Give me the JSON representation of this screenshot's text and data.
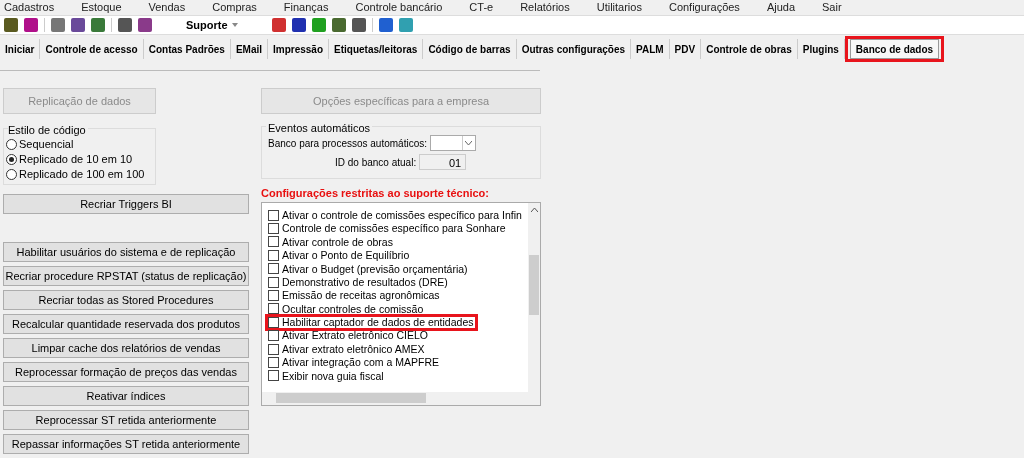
{
  "menu": [
    "Cadastros",
    "Estoque",
    "Vendas",
    "Compras",
    "Finanças",
    "Controle bancário",
    "CT-e",
    "Relatórios",
    "Utilitarios",
    "Configurações",
    "Ajuda",
    "Sair"
  ],
  "toolbar": {
    "dropdown": "Suporte"
  },
  "tabs": [
    {
      "label": "Iniciar",
      "selected": false,
      "highlighted": false
    },
    {
      "label": "Controle de acesso",
      "selected": false,
      "highlighted": false
    },
    {
      "label": "Contas Padrões",
      "selected": false,
      "highlighted": false
    },
    {
      "label": "EMail",
      "selected": false,
      "highlighted": false
    },
    {
      "label": "Impressão",
      "selected": false,
      "highlighted": false
    },
    {
      "label": "Etiquetas/leitoras",
      "selected": false,
      "highlighted": false
    },
    {
      "label": "Código de barras",
      "selected": false,
      "highlighted": false
    },
    {
      "label": "Outras configurações",
      "selected": false,
      "highlighted": false
    },
    {
      "label": "PALM",
      "selected": false,
      "highlighted": false
    },
    {
      "label": "PDV",
      "selected": false,
      "highlighted": false
    },
    {
      "label": "Controle de obras",
      "selected": false,
      "highlighted": false
    },
    {
      "label": "Plugins",
      "selected": false,
      "highlighted": false
    },
    {
      "label": "Banco de dados",
      "selected": true,
      "highlighted": true
    }
  ],
  "left": {
    "replication_button": {
      "label": "Replicação de dados",
      "disabled": true
    },
    "code_style": {
      "title": "Estilo de código",
      "options": [
        {
          "label": "Sequencial",
          "selected": false
        },
        {
          "label": "Replicado de 10 em 10",
          "selected": true
        },
        {
          "label": "Replicado de 100 em 100",
          "selected": false
        }
      ]
    },
    "triggers_button": "Recriar Triggers BI",
    "buttons": [
      "Habilitar usuários do sistema e de replicação",
      "Recriar procedure RPSTAT (status de replicação)",
      "Recriar todas as Stored Procedures",
      "Recalcular quantidade reservada dos produtos",
      "Limpar cache dos relatórios de vendas",
      "Reprocessar formação de preços das vendas",
      "Reativar índices",
      "Reprocessar ST retida anteriormente",
      "Repassar informações ST retida anteriormente"
    ]
  },
  "right": {
    "options_button": {
      "label": "Opções específicas para a empresa",
      "disabled": true
    },
    "events": {
      "title": "Eventos automáticos",
      "bank_label": "Banco para processos automáticos:",
      "id_label": "ID do banco atual:",
      "id_value": "01"
    },
    "restricted_title": "Configurações restritas ao suporte técnico:",
    "items": [
      {
        "label": "Ativar o controle de comissões específico para Infin",
        "checked": false,
        "highlighted": false
      },
      {
        "label": "Controle de comissões específico para Sonhare",
        "checked": false,
        "highlighted": false
      },
      {
        "label": "Ativar controle de obras",
        "checked": false,
        "highlighted": false
      },
      {
        "label": "Ativar o Ponto de Equilíbrio",
        "checked": false,
        "highlighted": false
      },
      {
        "label": "Ativar o Budget (previsão orçamentária)",
        "checked": false,
        "highlighted": false
      },
      {
        "label": "Demonstrativo de resultados (DRE)",
        "checked": false,
        "highlighted": false
      },
      {
        "label": "Emissão de receitas agronômicas",
        "checked": false,
        "highlighted": false
      },
      {
        "label": "Ocultar controles de comissão",
        "checked": false,
        "highlighted": false
      },
      {
        "label": "Habilitar captador de dados de entidades",
        "checked": false,
        "highlighted": true
      },
      {
        "label": "Ativar Extrato eletrônico CIELO",
        "checked": false,
        "highlighted": false
      },
      {
        "label": "Ativar extrato eletrônico AMEX",
        "checked": false,
        "highlighted": false
      },
      {
        "label": "Ativar integração com a MAPFRE",
        "checked": false,
        "highlighted": false
      },
      {
        "label": "Exibir nova guia fiscal",
        "checked": false,
        "highlighted": false
      }
    ]
  }
}
